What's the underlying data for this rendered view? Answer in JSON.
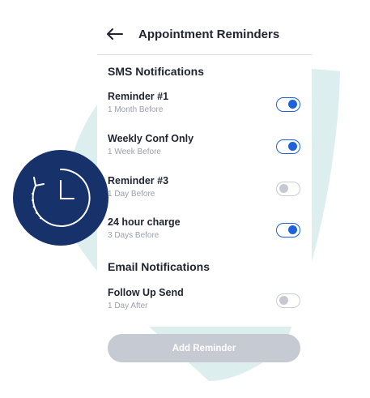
{
  "header": {
    "title": "Appointment Reminders",
    "back_icon": "arrow-left-icon"
  },
  "sms": {
    "title": "SMS Notifications",
    "items": [
      {
        "label": "Reminder #1",
        "subtitle": "1 Month Before",
        "enabled": true
      },
      {
        "label": "Weekly Conf Only",
        "subtitle": "1 Week Before",
        "enabled": true
      },
      {
        "label": "Reminder #3",
        "subtitle": "1 Day Before",
        "enabled": false
      },
      {
        "label": "24 hour charge",
        "subtitle": "3 Days Before",
        "enabled": true
      }
    ]
  },
  "email": {
    "title": "Email Notifications",
    "items": [
      {
        "label": "Follow Up Send",
        "subtitle": "1 Day After",
        "enabled": false
      }
    ]
  },
  "actions": {
    "add_label": "Add Reminder"
  },
  "decor": {
    "badge_icon": "clock-history-icon"
  },
  "colors": {
    "accent": "#1f61d8",
    "badge": "#17316b",
    "teal_shape": "#dcefee",
    "button_disabled": "#c6cad2"
  }
}
